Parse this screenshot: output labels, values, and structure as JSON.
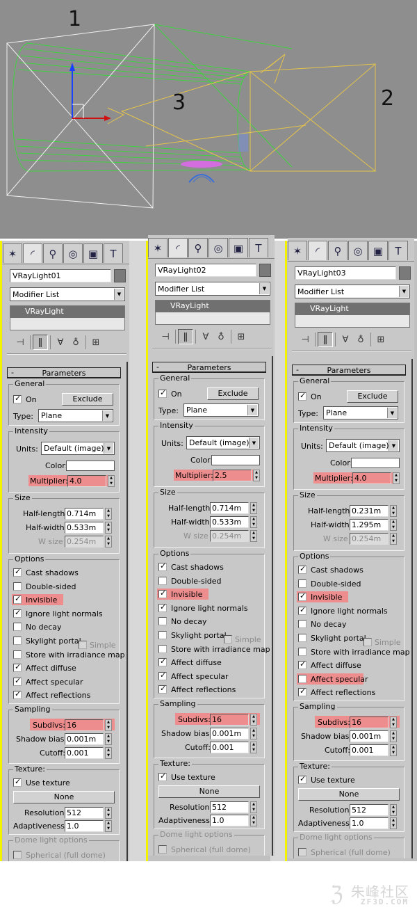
{
  "viewport": {
    "labels": [
      "1",
      "2",
      "3"
    ]
  },
  "panels": [
    {
      "name": "VRayLight01",
      "modifier_list": "Modifier List",
      "stack_item": "VRayLight",
      "rollout_title": "Parameters",
      "general": {
        "title": "General",
        "on_label": "On",
        "on": true,
        "exclude_label": "Exclude",
        "type_label": "Type:",
        "type_value": "Plane"
      },
      "intensity": {
        "title": "Intensity",
        "units_label": "Units:",
        "units_value": "Default (image)",
        "color_label": "Color:",
        "multiplier_label": "Multiplier:",
        "multiplier_value": "4.0"
      },
      "size": {
        "title": "Size",
        "half_length_label": "Half-length:",
        "half_length": "0.714m",
        "half_width_label": "Half-width:",
        "half_width": "0.533m",
        "w_size_label": "W size",
        "w_size": "0.254m"
      },
      "options": {
        "title": "Options",
        "items": [
          {
            "label": "Cast shadows",
            "checked": true,
            "enabled": true,
            "highlight": false
          },
          {
            "label": "Double-sided",
            "checked": false,
            "enabled": true,
            "highlight": false
          },
          {
            "label": "Invisible",
            "checked": true,
            "enabled": true,
            "highlight": true
          },
          {
            "label": "Ignore light normals",
            "checked": true,
            "enabled": true,
            "highlight": false
          },
          {
            "label": "No decay",
            "checked": false,
            "enabled": true,
            "highlight": false
          },
          {
            "label": "Skylight portal",
            "checked": false,
            "enabled": true,
            "highlight": false
          },
          {
            "label": "Store with irradiance map",
            "checked": false,
            "enabled": true,
            "highlight": false
          },
          {
            "label": "Affect diffuse",
            "checked": true,
            "enabled": true,
            "highlight": false
          },
          {
            "label": "Affect specular",
            "checked": true,
            "enabled": true,
            "highlight": false
          },
          {
            "label": "Affect reflections",
            "checked": true,
            "enabled": true,
            "highlight": false
          }
        ],
        "simple_label": "Simple"
      },
      "sampling": {
        "title": "Sampling",
        "subdivs_label": "Subdivs:",
        "subdivs": "16",
        "shadow_bias_label": "Shadow bias:",
        "shadow_bias": "0.001m",
        "cutoff_label": "Cutoff:",
        "cutoff": "0.001"
      },
      "texture": {
        "title": "Texture:",
        "use_texture_label": "Use texture",
        "use_texture": true,
        "none_label": "None",
        "resolution_label": "Resolution:",
        "resolution": "512",
        "adaptiveness_label": "Adaptiveness:",
        "adaptiveness": "1.0"
      },
      "dome": {
        "title": "Dome light options",
        "spherical_label": "Spherical (full dome)"
      }
    },
    {
      "name": "VRayLight02",
      "modifier_list": "Modifier List",
      "stack_item": "VRayLight",
      "rollout_title": "Parameters",
      "general": {
        "title": "General",
        "on_label": "On",
        "on": true,
        "exclude_label": "Exclude",
        "type_label": "Type:",
        "type_value": "Plane"
      },
      "intensity": {
        "title": "Intensity",
        "units_label": "Units:",
        "units_value": "Default (image)",
        "color_label": "Color:",
        "multiplier_label": "Multiplier:",
        "multiplier_value": "2.5"
      },
      "size": {
        "title": "Size",
        "half_length_label": "Half-length:",
        "half_length": "0.714m",
        "half_width_label": "Half-width:",
        "half_width": "0.533m",
        "w_size_label": "W size",
        "w_size": "0.254m"
      },
      "options": {
        "title": "Options",
        "items": [
          {
            "label": "Cast shadows",
            "checked": true,
            "enabled": true,
            "highlight": false
          },
          {
            "label": "Double-sided",
            "checked": false,
            "enabled": true,
            "highlight": false
          },
          {
            "label": "Invisible",
            "checked": true,
            "enabled": true,
            "highlight": true
          },
          {
            "label": "Ignore light normals",
            "checked": true,
            "enabled": true,
            "highlight": false
          },
          {
            "label": "No decay",
            "checked": false,
            "enabled": true,
            "highlight": false
          },
          {
            "label": "Skylight portal",
            "checked": false,
            "enabled": true,
            "highlight": false
          },
          {
            "label": "Store with irradiance map",
            "checked": false,
            "enabled": true,
            "highlight": false
          },
          {
            "label": "Affect diffuse",
            "checked": true,
            "enabled": true,
            "highlight": false
          },
          {
            "label": "Affect specular",
            "checked": true,
            "enabled": true,
            "highlight": false
          },
          {
            "label": "Affect reflections",
            "checked": true,
            "enabled": true,
            "highlight": false
          }
        ],
        "simple_label": "Simple"
      },
      "sampling": {
        "title": "Sampling",
        "subdivs_label": "Subdivs:",
        "subdivs": "16",
        "shadow_bias_label": "Shadow bias:",
        "shadow_bias": "0.001m",
        "cutoff_label": "Cutoff:",
        "cutoff": "0.001"
      },
      "texture": {
        "title": "Texture:",
        "use_texture_label": "Use texture",
        "use_texture": true,
        "none_label": "None",
        "resolution_label": "Resolution:",
        "resolution": "512",
        "adaptiveness_label": "Adaptiveness:",
        "adaptiveness": "1.0"
      },
      "dome": {
        "title": "Dome light options",
        "spherical_label": "Spherical (full dome)"
      }
    },
    {
      "name": "VRayLight03",
      "modifier_list": "Modifier List",
      "stack_item": "VRayLight",
      "rollout_title": "Parameters",
      "general": {
        "title": "General",
        "on_label": "On",
        "on": true,
        "exclude_label": "Exclude",
        "type_label": "Type:",
        "type_value": "Plane"
      },
      "intensity": {
        "title": "Intensity",
        "units_label": "Units:",
        "units_value": "Default (image)",
        "color_label": "Color:",
        "multiplier_label": "Multiplier:",
        "multiplier_value": "4.0"
      },
      "size": {
        "title": "Size",
        "half_length_label": "Half-length:",
        "half_length": "0.231m",
        "half_width_label": "Half-width:",
        "half_width": "1.295m",
        "w_size_label": "W size",
        "w_size": "0.254m"
      },
      "options": {
        "title": "Options",
        "items": [
          {
            "label": "Cast shadows",
            "checked": true,
            "enabled": true,
            "highlight": false
          },
          {
            "label": "Double-sided",
            "checked": false,
            "enabled": true,
            "highlight": false
          },
          {
            "label": "Invisible",
            "checked": true,
            "enabled": true,
            "highlight": true
          },
          {
            "label": "Ignore light normals",
            "checked": true,
            "enabled": true,
            "highlight": false
          },
          {
            "label": "No decay",
            "checked": false,
            "enabled": true,
            "highlight": false
          },
          {
            "label": "Skylight portal",
            "checked": false,
            "enabled": true,
            "highlight": false
          },
          {
            "label": "Store with irradiance map",
            "checked": false,
            "enabled": true,
            "highlight": false
          },
          {
            "label": "Affect diffuse",
            "checked": true,
            "enabled": true,
            "highlight": false
          },
          {
            "label": "Affect specular",
            "checked": false,
            "enabled": true,
            "highlight": true
          },
          {
            "label": "Affect reflections",
            "checked": true,
            "enabled": true,
            "highlight": false
          }
        ],
        "simple_label": "Simple"
      },
      "sampling": {
        "title": "Sampling",
        "subdivs_label": "Subdivs:",
        "subdivs": "16",
        "shadow_bias_label": "Shadow bias:",
        "shadow_bias": "0.001m",
        "cutoff_label": "Cutoff:",
        "cutoff": "0.001"
      },
      "texture": {
        "title": "Texture:",
        "use_texture_label": "Use texture",
        "use_texture": true,
        "none_label": "None",
        "resolution_label": "Resolution:",
        "resolution": "512",
        "adaptiveness_label": "Adaptiveness:",
        "adaptiveness": "1.0"
      },
      "dome": {
        "title": "Dome light options",
        "spherical_label": "Spherical (full dome)"
      }
    }
  ],
  "watermark": {
    "cn": "朱峰社区",
    "en": "ZF3D.COM"
  },
  "colors": {
    "highlight": "#ee8d8d",
    "viewport_bg": "#8e8e8e",
    "panel_bg": "#c8c8c8",
    "yellow_strip": "#f3f200",
    "green_wire": "#3fd43f",
    "yellow_wire": "#e6c44a"
  }
}
